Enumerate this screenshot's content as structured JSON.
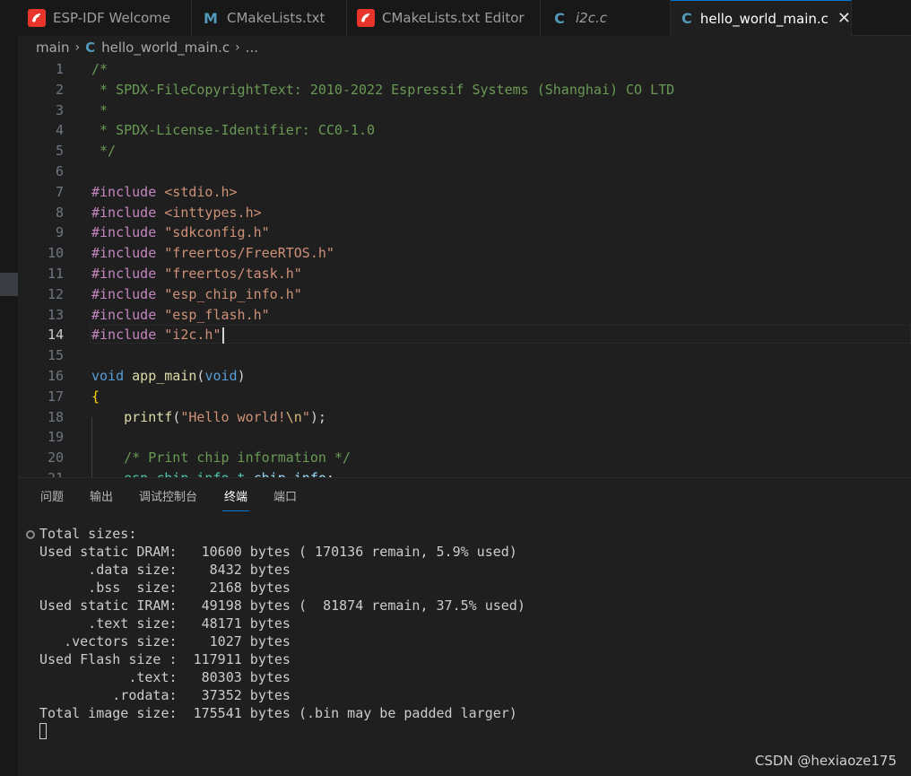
{
  "tabs": [
    {
      "label": "ESP-IDF Welcome",
      "icon": "espressif-icon"
    },
    {
      "label": "CMakeLists.txt",
      "icon": "markdown-m-icon"
    },
    {
      "label": "CMakeLists.txt Editor",
      "icon": "espressif-icon"
    },
    {
      "label": "i2c.c",
      "icon": "c-file-icon"
    },
    {
      "label": "hello_world_main.c",
      "icon": "c-file-icon",
      "close": "✕"
    }
  ],
  "breadcrumb": {
    "folder": "main",
    "sep": "›",
    "file_icon": "C",
    "file": "hello_world_main.c",
    "more": "..."
  },
  "editor": {
    "current_line": "14",
    "line_numbers": [
      "1",
      "2",
      "3",
      "4",
      "5",
      "6",
      "7",
      "8",
      "9",
      "10",
      "11",
      "12",
      "13",
      "14",
      "15",
      "16",
      "17",
      "18",
      "19",
      "20",
      "21"
    ]
  },
  "panel": {
    "tabs": [
      "问题",
      "输出",
      "调试控制台",
      "终端",
      "端口"
    ],
    "active_tab": "终端"
  },
  "terminal": {
    "lines": [
      "Total sizes:",
      "Used static DRAM:   10600 bytes ( 170136 remain, 5.9% used)",
      "      .data size:    8432 bytes",
      "      .bss  size:    2168 bytes",
      "Used static IRAM:   49198 bytes (  81874 remain, 37.5% used)",
      "      .text size:   48171 bytes",
      "   .vectors size:    1027 bytes",
      "Used Flash size :  117911 bytes",
      "           .text:   80303 bytes",
      "         .rodata:   37352 bytes",
      "Total image size:  175541 bytes (.bin may be padded larger)"
    ]
  },
  "watermark": "CSDN @hexiaoze175",
  "colors": {
    "accent": "#0078d4",
    "comment": "#6a9955",
    "preprocessor": "#c586c0",
    "string": "#ce9178",
    "keyword": "#569cd6",
    "function": "#dcdcaa"
  }
}
